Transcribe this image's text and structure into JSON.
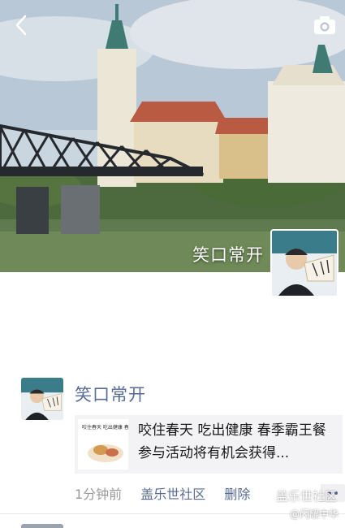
{
  "profile": {
    "name": "笑口常开"
  },
  "post": {
    "author": "笑口常开",
    "share_text": "咬住春天 吃出健康 春季霸王餐 参与活动将有机会获得...",
    "thumb_caption": "咬住春天 吃出健康 春季霸王餐",
    "time": "1分钟前",
    "source": "盖乐世社区",
    "delete_label": "删除"
  },
  "watermark": {
    "main": "盖乐世社区",
    "sub": "@闪耀中华"
  },
  "icons": {
    "back": "back-arrow-icon",
    "camera": "camera-icon",
    "more": "more-dots-icon"
  },
  "colors": {
    "link": "#576b95",
    "meta": "#999999"
  }
}
